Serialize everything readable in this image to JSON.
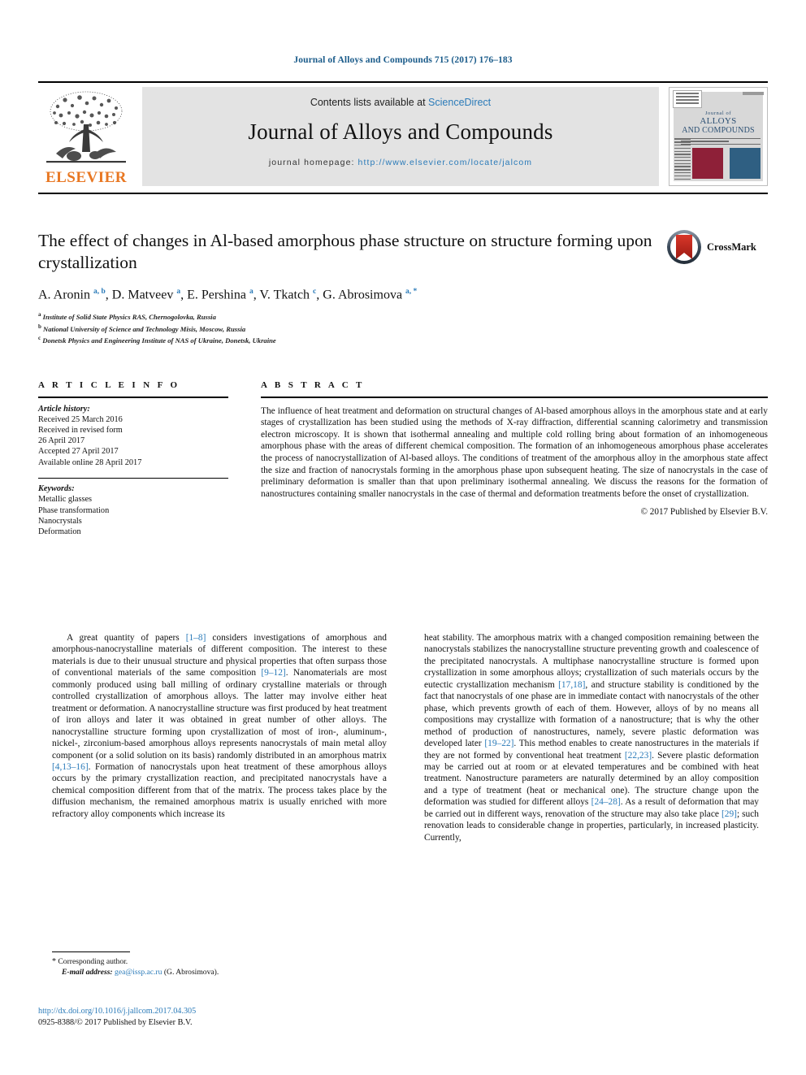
{
  "running_head": "Journal of Alloys and Compounds 715 (2017) 176–183",
  "masthead": {
    "contents_prefix": "Contents lists available at ",
    "sciencedirect": "ScienceDirect",
    "journal_title": "Journal of Alloys and Compounds",
    "homepage_prefix": "journal homepage: ",
    "homepage_url": "http://www.elsevier.com/locate/jalcom",
    "publisher": "ELSEVIER",
    "cover": {
      "line1": "Journal of",
      "line2": "ALLOYS",
      "line3": "AND COMPOUNDS"
    }
  },
  "article": {
    "title": "The effect of changes in Al-based amorphous phase structure on structure forming upon crystallization",
    "authors": [
      {
        "name": "A. Aronin",
        "marks": "a, b"
      },
      {
        "name": "D. Matveev",
        "marks": "a"
      },
      {
        "name": "E. Pershina",
        "marks": "a"
      },
      {
        "name": "V. Tkatch",
        "marks": "c"
      },
      {
        "name": "G. Abrosimova",
        "marks": "a, *"
      }
    ],
    "affiliations": [
      {
        "label": "a",
        "text": "Institute of Solid State Physics RAS, Chernogolovka, Russia"
      },
      {
        "label": "b",
        "text": "National University of Science and Technology Misis, Moscow, Russia"
      },
      {
        "label": "c",
        "text": "Donetsk Physics and Engineering Institute of NAS of Ukraine, Donetsk, Ukraine"
      }
    ],
    "crossmark_label": "CrossMark"
  },
  "article_info": {
    "heading": "A R T I C L E   I N F O",
    "history_label": "Article history:",
    "history": [
      "Received 25 March 2016",
      "Received in revised form",
      "26 April 2017",
      "Accepted 27 April 2017",
      "Available online 28 April 2017"
    ],
    "keywords_label": "Keywords:",
    "keywords": [
      "Metallic glasses",
      "Phase transformation",
      "Nanocrystals",
      "Deformation"
    ]
  },
  "abstract": {
    "heading": "A B S T R A C T",
    "text": "The influence of heat treatment and deformation on structural changes of Al-based amorphous alloys in the amorphous state and at early stages of crystallization has been studied using the methods of X-ray diffraction, differential scanning calorimetry and transmission electron microscopy. It is shown that isothermal annealing and multiple cold rolling bring about formation of an inhomogeneous amorphous phase with the areas of different chemical composition. The formation of an inhomogeneous amorphous phase accelerates the process of nanocrystallization of Al-based alloys. The conditions of treatment of the amorphous alloy in the amorphous state affect the size and fraction of nanocrystals forming in the amorphous phase upon subsequent heating. The size of nanocrystals in the case of preliminary deformation is smaller than that upon preliminary isothermal annealing. We discuss the reasons for the formation of nanostructures containing smaller nanocrystals in the case of thermal and deformation treatments before the onset of crystallization.",
    "copyright": "© 2017 Published by Elsevier B.V."
  },
  "body": {
    "left_segments": [
      {
        "t": "A great quantity of papers "
      },
      {
        "t": "[1–8]",
        "ref": true
      },
      {
        "t": " considers investigations of amorphous and amorphous-nanocrystalline materials of different composition. The interest to these materials is due to their unusual structure and physical properties that often surpass those of conventional materials of the same composition "
      },
      {
        "t": "[9–12]",
        "ref": true
      },
      {
        "t": ". Nanomaterials are most commonly produced using ball milling of ordinary crystalline materials or through controlled crystallization of amorphous alloys. The latter may involve either heat treatment or deformation. A nanocrystalline structure was first produced by heat treatment of iron alloys and later it was obtained in great number of other alloys. The nanocrystalline structure forming upon crystallization of most of iron-, aluminum-, nickel-, zirconium-based amorphous alloys represents nanocrystals of main metal alloy component (or a solid solution on its basis) randomly distributed in an amorphous matrix "
      },
      {
        "t": "[4,13–16]",
        "ref": true
      },
      {
        "t": ". Formation of nanocrystals upon heat treatment of these amorphous alloys occurs by the primary crystallization reaction, and precipitated nanocrystals have a chemical composition different from that of the matrix. The process takes place by the diffusion mechanism, the remained amorphous matrix is usually enriched with more refractory alloy components which increase its"
      }
    ],
    "right_segments": [
      {
        "t": "heat stability. The amorphous matrix with a changed composition remaining between the nanocrystals stabilizes the nanocrystalline structure preventing growth and coalescence of the precipitated nanocrystals. A multiphase nanocrystalline structure is formed upon crystallization in some amorphous alloys; crystallization of such materials occurs by the eutectic crystallization mechanism "
      },
      {
        "t": "[17,18]",
        "ref": true
      },
      {
        "t": ", and structure stability is conditioned by the fact that nanocrystals of one phase are in immediate contact with nanocrystals of the other phase, which prevents growth of each of them. However, alloys of by no means all compositions may crystallize with formation of a nanostructure; that is why the other method of production of nanostructures, namely, severe plastic deformation was developed later "
      },
      {
        "t": "[19–22]",
        "ref": true
      },
      {
        "t": ". This method enables to create nanostructures in the materials if they are not formed by conventional heat treatment "
      },
      {
        "t": "[22,23]",
        "ref": true
      },
      {
        "t": ". Severe plastic deformation may be carried out at room or at elevated temperatures and be combined with heat treatment. Nanostructure parameters are naturally determined by an alloy composition and a type of treatment (heat or mechanical one). The structure change upon the deformation was studied for different alloys "
      },
      {
        "t": "[24–28]",
        "ref": true
      },
      {
        "t": ". As a result of deformation that may be carried out in different ways, renovation of the structure may also take place "
      },
      {
        "t": "[29]",
        "ref": true
      },
      {
        "t": "; such renovation leads to considerable change in properties, particularly, in increased plasticity. Currently,"
      }
    ]
  },
  "footer": {
    "corresponding_star": "*",
    "corresponding_label": "Corresponding author.",
    "email_label": "E-mail address:",
    "email": "gea@issp.ac.ru",
    "email_owner": "(G. Abrosimova).",
    "doi": "http://dx.doi.org/10.1016/j.jallcom.2017.04.305",
    "issn_line": "0925-8388/© 2017 Published by Elsevier B.V."
  },
  "colors": {
    "link": "#2b7bb9",
    "runhead": "#1a5b8a",
    "elsevier_orange": "#e87722",
    "masthead_grey": "#e3e3e3",
    "cover_red": "#8e2038",
    "cover_blue": "#2f5f82"
  }
}
